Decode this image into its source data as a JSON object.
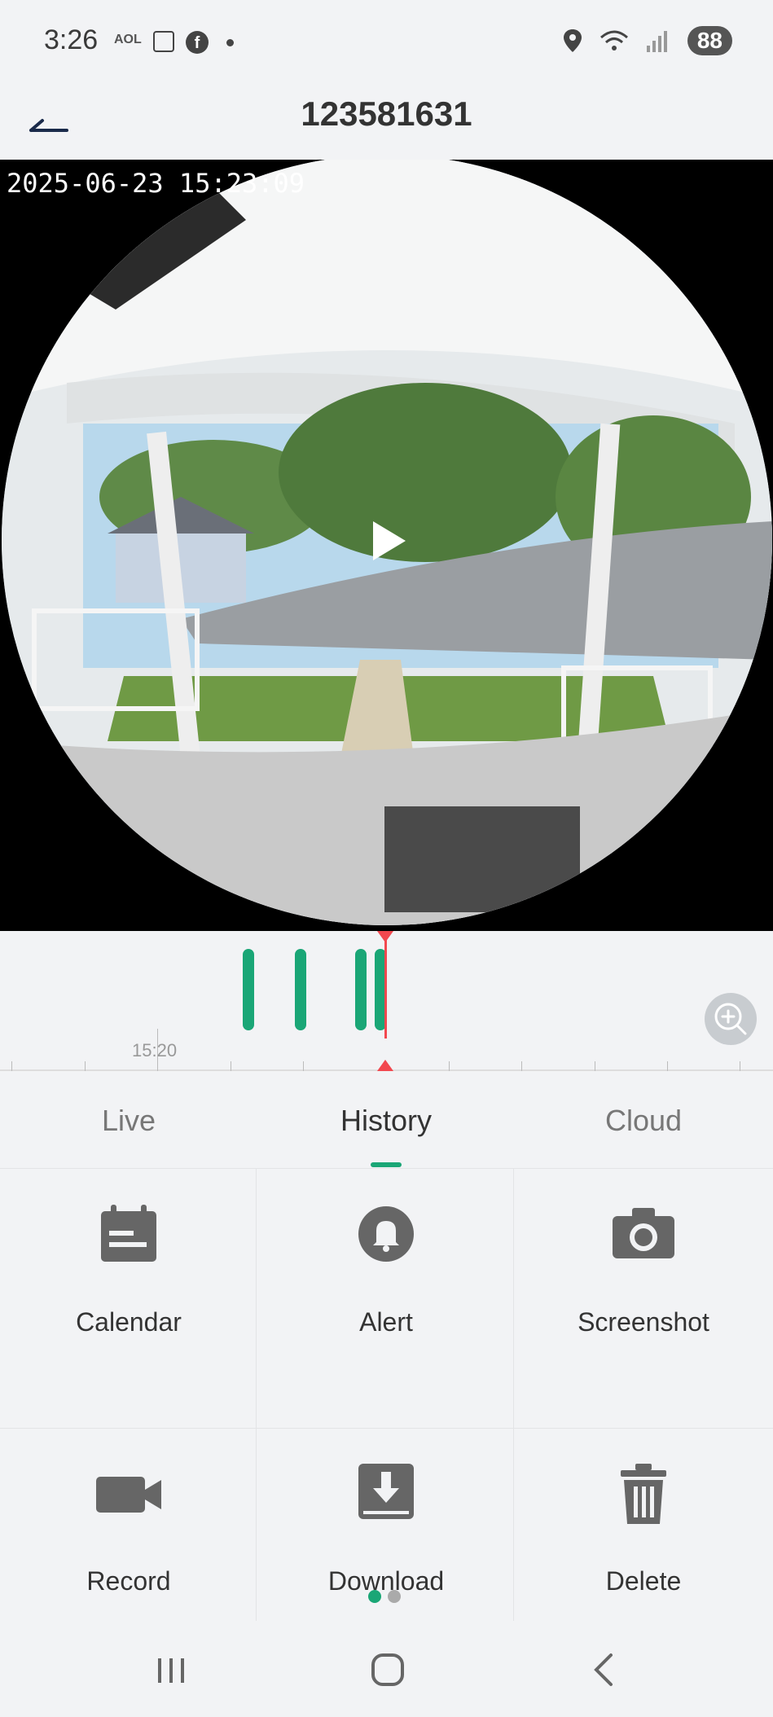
{
  "status_bar": {
    "time": "3:26",
    "app_label": "AOL",
    "battery": "88"
  },
  "header": {
    "title": "123581631"
  },
  "video": {
    "timestamp": "2025-06-23 15:23:09"
  },
  "timeline": {
    "tick_label": "15:20"
  },
  "tabs": [
    {
      "label": "Live"
    },
    {
      "label": "History"
    },
    {
      "label": "Cloud"
    }
  ],
  "actions": [
    {
      "label": "Calendar",
      "icon": "calendar-icon"
    },
    {
      "label": "Alert",
      "icon": "bell-icon"
    },
    {
      "label": "Screenshot",
      "icon": "camera-icon"
    },
    {
      "label": "Record",
      "icon": "video-camera-icon"
    },
    {
      "label": "Download",
      "icon": "download-icon"
    },
    {
      "label": "Delete",
      "icon": "trash-icon"
    }
  ],
  "colors": {
    "accent": "#1aa676",
    "cursor": "#f2484f",
    "icon": "#666666"
  }
}
